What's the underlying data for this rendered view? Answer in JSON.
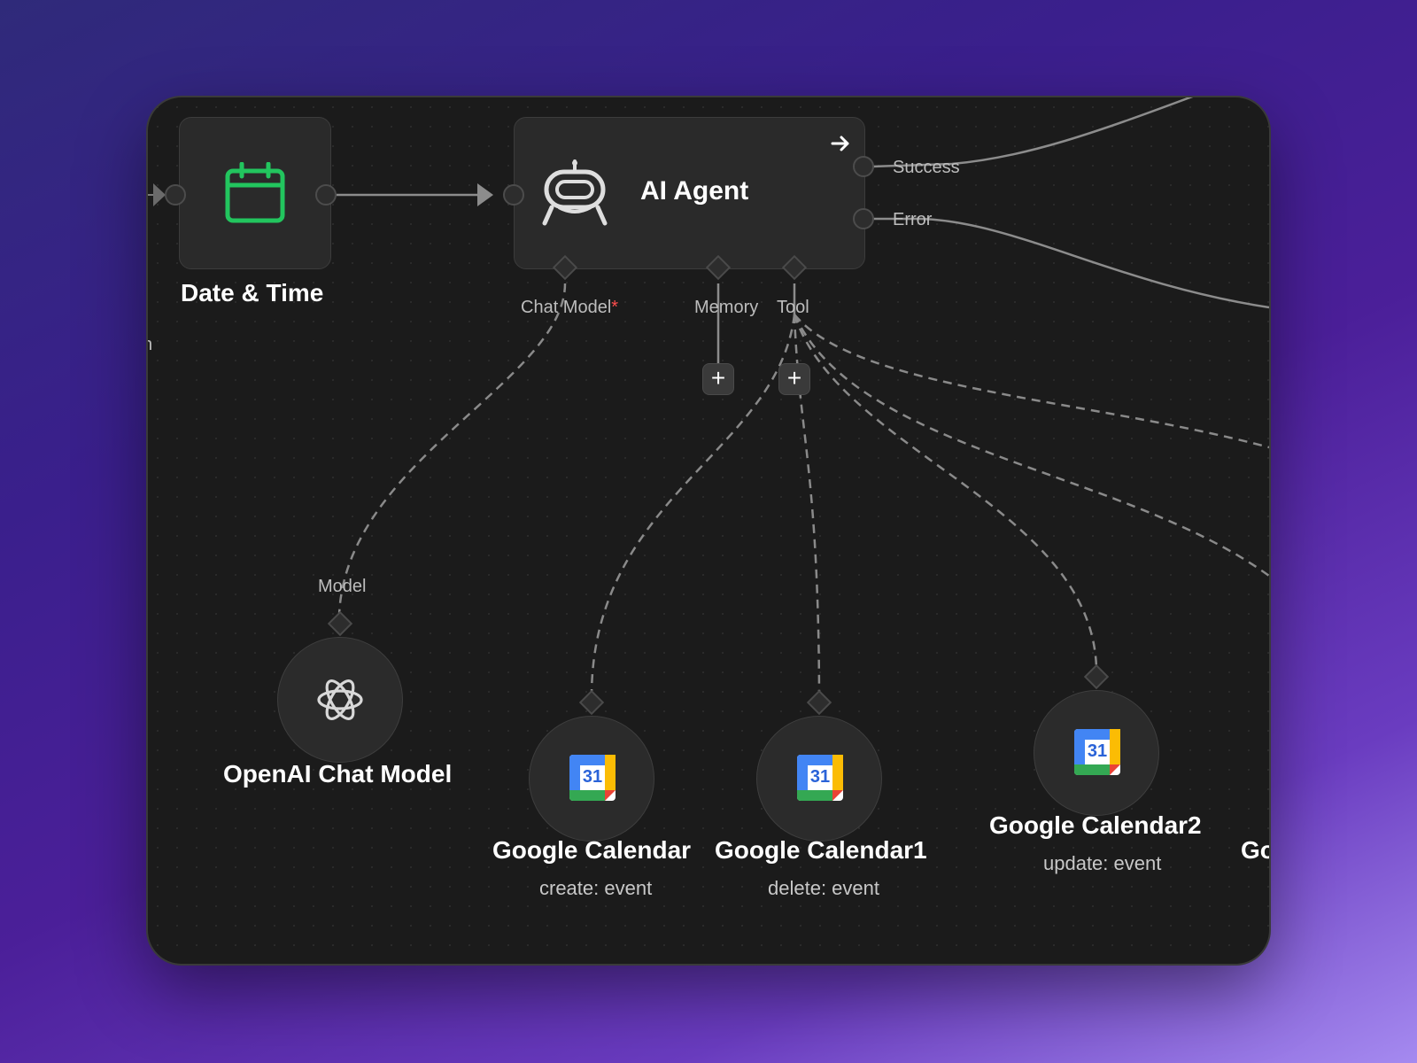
{
  "nodes": {
    "date_time": {
      "title": "Date & Time",
      "icon": "calendar-icon",
      "icon_color": "#22c55e"
    },
    "ai_agent": {
      "title": "AI Agent",
      "icon": "robot-icon",
      "outputs": {
        "success": "Success",
        "error": "Error"
      },
      "inputs": {
        "chat_model": "Chat Model",
        "required_mark": "*",
        "memory": "Memory",
        "tool": "Tool"
      },
      "add_memory_label": "+",
      "add_tool_label": "+"
    },
    "openai_chat_model": {
      "title": "OpenAI Chat Model",
      "port_label": "Model",
      "icon": "openai-icon"
    },
    "google_calendar": {
      "title": "Google Calendar",
      "subtitle": "create: event",
      "icon": "google-calendar-icon",
      "day": "31"
    },
    "google_calendar1": {
      "title": "Google Calendar1",
      "subtitle": "delete: event",
      "icon": "google-calendar-icon",
      "day": "31"
    },
    "google_calendar2": {
      "title": "Google Calendar2",
      "subtitle": "update: event",
      "icon": "google-calendar-icon",
      "day": "31"
    },
    "google_calendar3_partial": {
      "title": "Go"
    },
    "left_partial_label": "n"
  },
  "colors": {
    "canvas": "#1b1b1b",
    "node": "#2a2a2a",
    "wire": "#8c8c8c",
    "required": "#ff4d4d"
  }
}
